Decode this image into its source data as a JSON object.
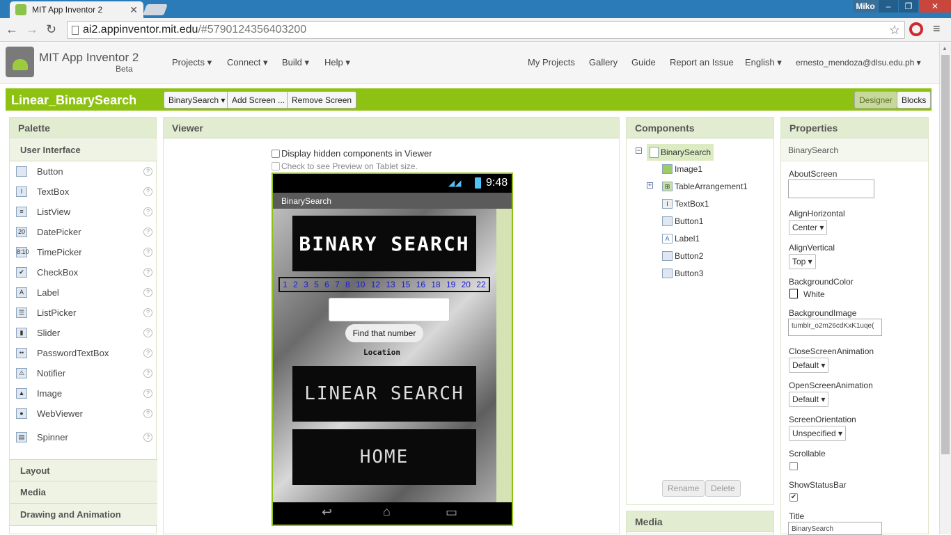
{
  "browser": {
    "tab_title": "MIT App Inventor 2",
    "user": "Miko",
    "url_host": "ai2.appinventor.mit.edu",
    "url_path": "/#5790124356403200"
  },
  "header": {
    "app_name": "MIT App Inventor 2",
    "beta": "Beta",
    "menus": [
      "Projects ▾",
      "Connect ▾",
      "Build ▾",
      "Help ▾"
    ],
    "right_links": [
      "My Projects",
      "Gallery",
      "Guide",
      "Report an Issue",
      "English ▾",
      "ernesto_mendoza@dlsu.edu.ph ▾"
    ]
  },
  "project": {
    "title": "Linear_BinarySearch",
    "screen_select": "BinarySearch ▾",
    "add_screen": "Add Screen ...",
    "remove_screen": "Remove Screen",
    "designer": "Designer",
    "blocks": "Blocks"
  },
  "palette": {
    "title": "Palette",
    "section": "User Interface",
    "items": [
      {
        "label": "Button",
        "icon": "button-icon"
      },
      {
        "label": "TextBox",
        "icon": "textbox-icon"
      },
      {
        "label": "ListView",
        "icon": "listview-icon"
      },
      {
        "label": "DatePicker",
        "icon": "datepicker-icon"
      },
      {
        "label": "TimePicker",
        "icon": "timepicker-icon"
      },
      {
        "label": "CheckBox",
        "icon": "checkbox-icon"
      },
      {
        "label": "Label",
        "icon": "label-icon"
      },
      {
        "label": "ListPicker",
        "icon": "listpicker-icon"
      },
      {
        "label": "Slider",
        "icon": "slider-icon"
      },
      {
        "label": "PasswordTextBox",
        "icon": "password-icon"
      },
      {
        "label": "Notifier",
        "icon": "notifier-icon"
      },
      {
        "label": "Image",
        "icon": "image-icon"
      },
      {
        "label": "WebViewer",
        "icon": "webviewer-icon"
      },
      {
        "label": "Spinner",
        "icon": "spinner-icon"
      }
    ],
    "help": "?",
    "collapsed": [
      "Layout",
      "Media",
      "Drawing and Animation"
    ]
  },
  "viewer": {
    "title": "Viewer",
    "hidden_toggle": "Display hidden components in Viewer",
    "tablet_toggle": "Check to see Preview on Tablet size.",
    "time": "9:48",
    "screen_title": "BinarySearch",
    "banner1": "BINARY SEARCH",
    "numbers": [
      "1",
      "2",
      "3",
      "5",
      "6",
      "7",
      "8",
      "10",
      "12",
      "13",
      "15",
      "16",
      "18",
      "19",
      "20",
      "22"
    ],
    "button_find": "Find that number",
    "location": "Location",
    "banner2": "LINEAR SEARCH",
    "banner3": "HOME"
  },
  "components": {
    "title": "Components",
    "items": [
      "BinarySearch",
      "Image1",
      "TableArrangement1",
      "TextBox1",
      "Button1",
      "Label1",
      "Button2",
      "Button3"
    ],
    "rename": "Rename",
    "delete": "Delete",
    "media_title": "Media"
  },
  "properties": {
    "title": "Properties",
    "subject": "BinarySearch",
    "about_label": "AboutScreen",
    "align_h_label": "AlignHorizontal",
    "align_h": "Center ▾",
    "align_v_label": "AlignVertical",
    "align_v": "Top ▾",
    "bg_color_label": "BackgroundColor",
    "bg_color": "White",
    "bg_image_label": "BackgroundImage",
    "bg_image": "tumblr_o2m26cdKxK1uqe(",
    "close_anim_label": "CloseScreenAnimation",
    "close_anim": "Default ▾",
    "open_anim_label": "OpenScreenAnimation",
    "open_anim": "Default ▾",
    "orientation_label": "ScreenOrientation",
    "orientation": "Unspecified ▾",
    "scrollable_label": "Scrollable",
    "statusbar_label": "ShowStatusBar",
    "title_label": "Title",
    "title_value": "BinarySearch"
  },
  "colors": {
    "accent": "#8dc112",
    "chrome": "#2a7bb7"
  }
}
